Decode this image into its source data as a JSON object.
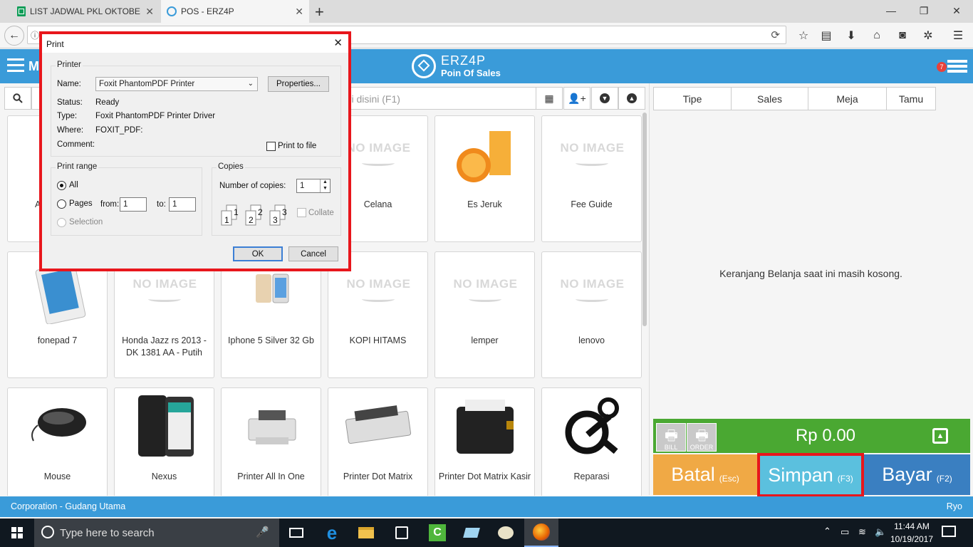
{
  "browser": {
    "tabs": [
      {
        "title": "LIST JADWAL PKL OKTOBER",
        "icon": "sheets-icon"
      },
      {
        "title": "POS - ERZ4P",
        "icon": "erzap-icon"
      }
    ],
    "new_tab": "+",
    "window_controls": [
      "—",
      "❐",
      "✕"
    ]
  },
  "app": {
    "menu_label": "M",
    "brand_name": "ERZ4P",
    "brand_sub": "Poin Of Sales",
    "notif_count": "7",
    "search_placeholder": "ori disini (F1)",
    "colors": {
      "header": "#3a9bd9",
      "green": "#4aa832",
      "orange": "#f0a945",
      "cyan": "#5bc0de",
      "blue": "#3a7fc1"
    }
  },
  "products": [
    {
      "name": "A",
      "image": "tablet-black"
    },
    {
      "name": "",
      "image": "hidden"
    },
    {
      "name": "",
      "image": "hidden"
    },
    {
      "name": "Celana",
      "image": "noimage"
    },
    {
      "name": "Es Jeruk",
      "image": "orange-juice"
    },
    {
      "name": "Fee Guide",
      "image": "noimage"
    },
    {
      "name": "fonepad 7",
      "image": "tablet-white"
    },
    {
      "name": "Honda Jazz rs 2013 - DK 1381 AA - Putih",
      "image": "noimage"
    },
    {
      "name": "Iphone 5 Silver 32 Gb",
      "image": "iphone"
    },
    {
      "name": "KOPI HITAMS",
      "image": "noimage"
    },
    {
      "name": "lemper",
      "image": "noimage"
    },
    {
      "name": "lenovo",
      "image": "noimage"
    },
    {
      "name": "Mouse",
      "image": "mouse"
    },
    {
      "name": "Nexus",
      "image": "phone"
    },
    {
      "name": "Printer All In One",
      "image": "printer-aio"
    },
    {
      "name": "Printer Dot Matrix",
      "image": "printer-dot"
    },
    {
      "name": "Printer Dot Matrix Kasir",
      "image": "printer-kasir"
    },
    {
      "name": "Reparasi",
      "image": "gear-wrench"
    }
  ],
  "noimage_text": "NO IMAGE",
  "cart": {
    "tabs": [
      "Tipe",
      "Sales",
      "Meja",
      "Tamu"
    ],
    "empty_message": "Keranjang Belanja saat ini masih kosong.",
    "bill_label": "BILL",
    "order_label": "ORDER",
    "total": "Rp 0.00",
    "batal": {
      "label": "Batal",
      "key": "(Esc)"
    },
    "simpan": {
      "label": "Simpan",
      "key": "(F3)"
    },
    "bayar": {
      "label": "Bayar",
      "key": "(F2)"
    }
  },
  "statusbar": {
    "left": "Corporation - Gudang Utama",
    "right": "Ryo"
  },
  "taskbar": {
    "search_placeholder": "Type here to search",
    "time": "11:44 AM",
    "date": "10/19/2017"
  },
  "dialog": {
    "title": "Print",
    "printer_group": "Printer",
    "name_label": "Name:",
    "name_value": "Foxit PhantomPDF Printer",
    "properties": "Properties...",
    "status_label": "Status:",
    "status_value": "Ready",
    "type_label": "Type:",
    "type_value": "Foxit PhantomPDF Printer Driver",
    "where_label": "Where:",
    "where_value": "FOXIT_PDF:",
    "comment_label": "Comment:",
    "print_to_file": "Print to file",
    "range_group": "Print range",
    "all": "All",
    "pages": "Pages",
    "from_label": "from:",
    "from_value": "1",
    "to_label": "to:",
    "to_value": "1",
    "selection": "Selection",
    "copies_group": "Copies",
    "copies_label": "Number of copies:",
    "copies_value": "1",
    "collate": "Collate",
    "ok": "OK",
    "cancel": "Cancel"
  }
}
